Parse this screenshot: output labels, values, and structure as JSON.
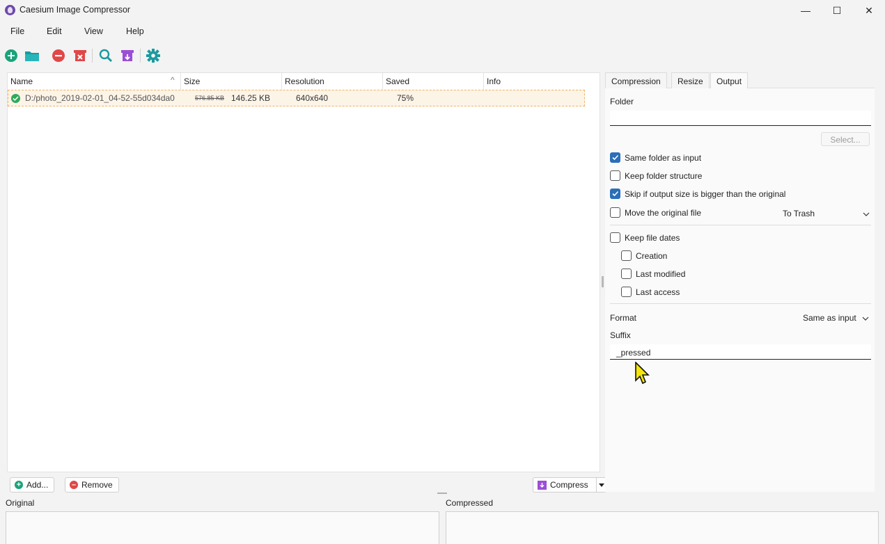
{
  "window": {
    "title": "Caesium Image Compressor",
    "minimize": "—",
    "maximize": "☐",
    "close": "✕"
  },
  "menu": [
    "File",
    "Edit",
    "View",
    "Help"
  ],
  "toolbar_icons": [
    "add-icon",
    "folder-open-icon",
    "remove-icon",
    "clear-list-icon",
    "preview-icon",
    "compress-icon",
    "settings-icon"
  ],
  "table": {
    "columns": [
      "Name",
      "Size",
      "Resolution",
      "Saved",
      "Info"
    ],
    "rows": [
      {
        "name": "D:/photo_2019-02-01_04-52-55d034da0",
        "original_size": "576.85 KB",
        "compressed_size": "146.25 KB",
        "resolution": "640x640",
        "saved": "75%",
        "info": ""
      }
    ]
  },
  "bottom": {
    "add": "Add...",
    "remove": "Remove",
    "compress": "Compress"
  },
  "preview": {
    "original": "Original",
    "compressed": "Compressed"
  },
  "settings": {
    "tabs": [
      "Compression",
      "Resize",
      "Output"
    ],
    "active_tab": "Output",
    "folder_label": "Folder",
    "folder_value": "",
    "select_button": "Select...",
    "same_folder": "Same folder as input",
    "keep_structure": "Keep folder structure",
    "skip_bigger": "Skip if output size is bigger than the original",
    "move_original": "Move the original file",
    "move_target": "To Trash",
    "keep_dates": "Keep file dates",
    "creation": "Creation",
    "last_modified": "Last modified",
    "last_access": "Last access",
    "format_label": "Format",
    "format_value": "Same as input",
    "suffix_label": "Suffix",
    "suffix_value": "_pressed"
  },
  "colors": {
    "accent": "#2a6fb8",
    "green": "#1aa37a",
    "red": "#e04848",
    "purple": "#9b4fd6",
    "teal": "#1a9aa0"
  }
}
